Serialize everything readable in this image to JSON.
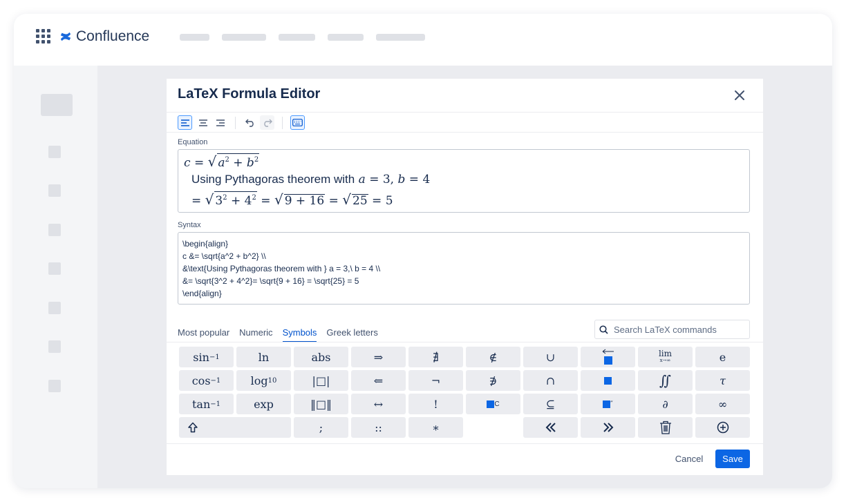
{
  "app": {
    "name": "Confluence",
    "brand_color": "#1868db"
  },
  "dialog": {
    "title": "LaTeX Formula Editor",
    "equation_label": "Equation",
    "syntax_label": "Syntax",
    "equation": {
      "line1": {
        "lhs": "c",
        "eq": "=",
        "rad_a": "a",
        "exp": "2",
        "plus": "+",
        "rad_b": "b"
      },
      "line2": {
        "text": "Using Pythagoras theorem with",
        "a": "a",
        "eq1": "=",
        "three": "3,",
        "b": "b",
        "eq2": "=",
        "four": "4"
      },
      "line3": {
        "eq": "=",
        "r1a": "3",
        "e1": "2",
        "plus1": "+",
        "r1b": "4",
        "e2": "2",
        "eq2": "=",
        "r2": "9 + 16",
        "eq3": "=",
        "r3": "25",
        "eq4": "=",
        "res": "5"
      }
    },
    "syntax_lines": [
      "\\begin{align}",
      "c &= \\sqrt{a^2 + b^2} \\\\",
      "&\\text{Using Pythagoras theorem with } a = 3,\\ b = 4 \\\\",
      "&= \\sqrt{3^2 + 4^2}= \\sqrt{9 + 16} = \\sqrt{25} = 5",
      "\\end{align}"
    ],
    "tabs": [
      {
        "label": "Most popular",
        "active": false
      },
      {
        "label": "Numeric",
        "active": false
      },
      {
        "label": "Symbols",
        "active": true
      },
      {
        "label": "Greek letters",
        "active": false
      }
    ],
    "search_placeholder": "Search LaTeX commands",
    "keys": {
      "row1": {
        "sin": "sin",
        "sin_exp": "−1",
        "ln": "ln",
        "abs": "abs",
        "implies": "⇒",
        "nexists": "∄",
        "notin": "∉",
        "cup": "∪",
        "lim_top": "lim",
        "lim_bottom": "x→∞",
        "e": "e"
      },
      "row2": {
        "cos": "cos",
        "cos_exp": "−1",
        "log": "log",
        "log_sub": "10",
        "norm_abs": "|□|",
        "impliedby": "⇐",
        "neg": "¬",
        "nni": "∌",
        "cap": "∩",
        "iint": "∬",
        "tau": "τ"
      },
      "row3": {
        "tan": "tan",
        "tan_exp": "−1",
        "exp": "exp",
        "norm": "‖□‖",
        "iff": "↔",
        "fact": "!",
        "comp_exp": "C",
        "subseteq": "⊆",
        "dprime_exp": "″",
        "partial": "∂",
        "infty": "∞"
      },
      "row4": {
        "semicolon": ";",
        "dcolon": "::",
        "ast": "∗"
      }
    },
    "cancel_label": "Cancel",
    "save_label": "Save",
    "accent_color": "#0c66e4"
  }
}
